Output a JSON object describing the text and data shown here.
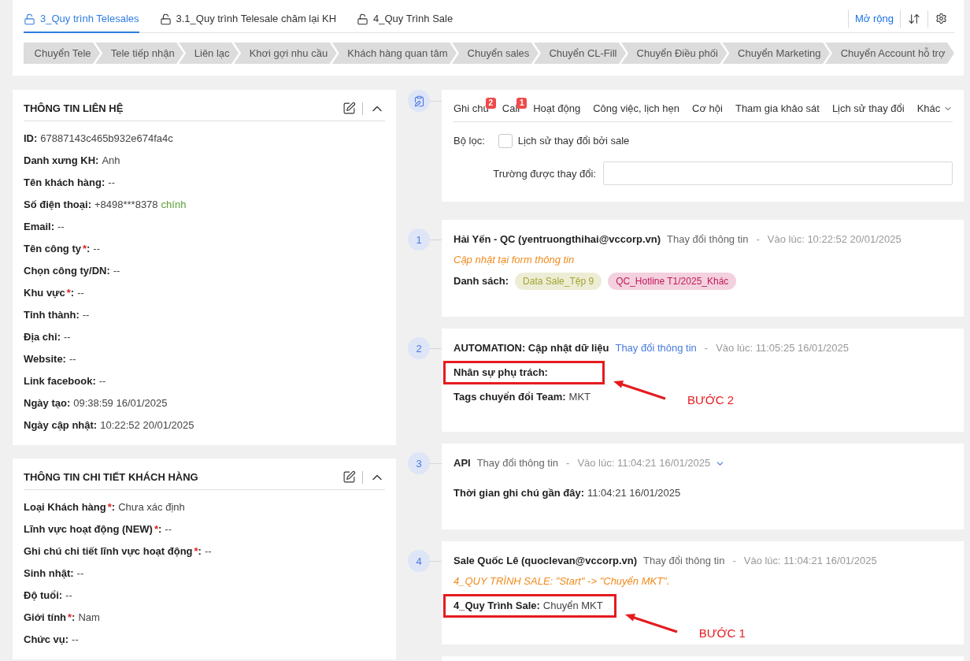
{
  "process_tabs": [
    {
      "label": "3_Quy trình Telesales",
      "selected": true
    },
    {
      "label": "3.1_Quy trình Telesale chăm lại KH",
      "selected": false
    },
    {
      "label": "4_Quy Trình Sale",
      "selected": false
    }
  ],
  "toolbar": {
    "expand_link": "Mở rộng"
  },
  "stages": [
    "Chuyển Tele",
    "Tele tiếp nhận",
    "Liên lạc",
    "Khơi gợi nhu cầu",
    "Khách hàng quan tâm",
    "Chuyển sales",
    "Chuyển CL-Fill",
    "Chuyển Điều phối",
    "Chuyển Marketing",
    "Chuyển Account hỗ trợ"
  ],
  "contact_card": {
    "title": "THÔNG TIN LIÊN HỆ",
    "fields": [
      {
        "label": "ID",
        "colon": ":",
        "content": "67887143c465b932e674fa4c"
      },
      {
        "label": "Danh xưng KH",
        "colon": ":",
        "content": "Anh"
      },
      {
        "label": "Tên khách hàng",
        "colon": ":",
        "content": "--"
      },
      {
        "label": "Số điện thoại",
        "colon": ":",
        "content": "+8498***8378",
        "badge": "chính"
      },
      {
        "label": "Email",
        "colon": ":",
        "content": "--"
      },
      {
        "label": "Tên công ty",
        "asterisk": "*",
        "colon": ":",
        "content": "--"
      },
      {
        "label": "Chọn công ty/DN",
        "colon": ":",
        "content": "--"
      },
      {
        "label": "Khu vực",
        "asterisk": "*",
        "colon": ":",
        "content": "--"
      },
      {
        "label": "Tỉnh thành",
        "colon": ":",
        "content": "--"
      },
      {
        "label": "Địa chỉ",
        "colon": ":",
        "content": "--"
      },
      {
        "label": "Website",
        "colon": ":",
        "content": "--"
      },
      {
        "label": "Link facebook",
        "colon": ":",
        "content": "--"
      },
      {
        "label": "Ngày tạo",
        "colon": ":",
        "content": "09:38:59 16/01/2025"
      },
      {
        "label": "Ngày cập nhật",
        "colon": ":",
        "content": "10:22:52 20/01/2025"
      }
    ]
  },
  "detail_card": {
    "title": "THÔNG TIN CHI TIẾT KHÁCH HÀNG",
    "fields": [
      {
        "label": "Loại Khách hàng",
        "asterisk": "*",
        "colon": ":",
        "content": "Chưa xác định"
      },
      {
        "label": "Lĩnh vực hoạt động (NEW)",
        "asterisk": "*",
        "colon": ":",
        "content": "--"
      },
      {
        "label": "Ghi chú chi tiết lĩnh vực hoạt động",
        "asterisk": "*",
        "colon": ":",
        "content": "--"
      },
      {
        "label": "Sinh nhật",
        "colon": ":",
        "content": "--"
      },
      {
        "label": "Độ tuổi",
        "colon": ":",
        "content": "--"
      },
      {
        "label": "Giới tính",
        "asterisk": "*",
        "colon": ":",
        "content": "Nam"
      },
      {
        "label": "Chức vụ",
        "colon": ":",
        "content": "--"
      }
    ]
  },
  "activity": {
    "tabs": [
      {
        "kind": "tab",
        "label": "Ghi chú",
        "badge": "2"
      },
      {
        "kind": "tab",
        "label": "Call",
        "badge": "1"
      },
      {
        "kind": "tab",
        "label": "Hoạt động"
      },
      {
        "kind": "tab",
        "label": "Công việc, lịch hẹn"
      },
      {
        "kind": "tab",
        "label": "Cơ hội"
      },
      {
        "kind": "tab",
        "label": "Tham gia khảo sát"
      },
      {
        "kind": "tab",
        "label": "Lịch sử thay đổi"
      },
      {
        "kind": "dropdown",
        "label": "Khác"
      }
    ],
    "filter": {
      "label": "Bộ lọc:",
      "checked": false,
      "checkbox_label": "Lịch sử thay đổi bởi sale",
      "field_label": "Trường được thay đổi:"
    }
  },
  "history": [
    {
      "number": "1",
      "author": "Hải Yến - QC (yentruongthihai@vccorp.vn)",
      "action": "Thay đổi thông tin",
      "action_link": false,
      "separator": "-",
      "time": "Vào lúc: 10:22:52 20/01/2025",
      "note": "Cập nhật tại form thông tin",
      "fields": [
        {
          "kind": "tags",
          "label": "Danh sách:",
          "highlighted": false,
          "tags": [
            {
              "text": "Data Sale_Tệp 9",
              "color": "#a3a332"
            },
            {
              "text": "QC_Hotline T1/2025_Khác",
              "color": "#c2185b"
            }
          ]
        }
      ]
    },
    {
      "number": "2",
      "author": "AUTOMATION: Cập nhật dữ liệu",
      "action": "Thay đổi thông tin",
      "action_link": true,
      "separator": "-",
      "time": "Vào lúc: 11:05:25 16/01/2025",
      "fields": [
        {
          "kind": "text",
          "label": "Nhân sự phụ trách:",
          "highlighted": true,
          "callout": "BƯỚC 2"
        },
        {
          "kind": "text",
          "label": "Tags chuyển đổi Team:",
          "value": "MKT",
          "highlighted": false
        }
      ]
    },
    {
      "number": "3",
      "author": "API",
      "action": "Thay đổi thông tin",
      "action_link": false,
      "separator": "-",
      "time": "Vào lúc: 11:04:21 16/01/2025",
      "expanded": false,
      "fields": [
        {
          "kind": "text",
          "label": "Thời gian ghi chú gần đây:",
          "value": "11:04:21 16/01/2025",
          "highlighted": false
        }
      ]
    },
    {
      "number": "4",
      "author": "Sale Quốc Lê (quoclevan@vccorp.vn)",
      "action": "Thay đổi thông tin",
      "action_link": false,
      "separator": "-",
      "time": "Vào lúc: 11:04:21 16/01/2025",
      "note": "4_QUY TRÌNH SALE: \"Start\" -> \"Chuyển MKT\".",
      "fields": [
        {
          "kind": "text",
          "label": "4_Quy Trình Sale:",
          "value": "Chuyển MKT",
          "highlighted": true,
          "callout": "BƯỚC 1"
        }
      ]
    }
  ]
}
